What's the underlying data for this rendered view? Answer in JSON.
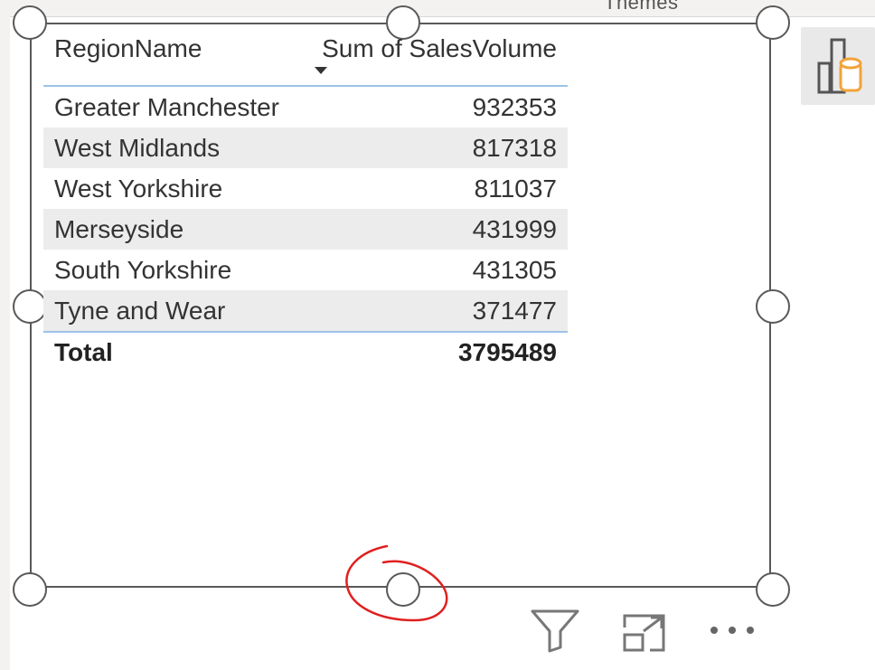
{
  "ribbon": {
    "themes_label": "Themes"
  },
  "table": {
    "headers": {
      "region": "RegionName",
      "sales": "Sum of SalesVolume"
    },
    "rows": [
      {
        "region": "Greater Manchester",
        "value": "932353"
      },
      {
        "region": "West Midlands",
        "value": "817318"
      },
      {
        "region": "West Yorkshire",
        "value": "811037"
      },
      {
        "region": "Merseyside",
        "value": "431999"
      },
      {
        "region": "South Yorkshire",
        "value": "431305"
      },
      {
        "region": "Tyne and Wear",
        "value": "371477"
      }
    ],
    "total": {
      "label": "Total",
      "value": "3795489"
    }
  },
  "icons": {
    "side_pane": "data-table-icon",
    "filter": "filter-icon",
    "focus_mode": "focus-mode-icon",
    "more_options": "more-options-icon"
  },
  "colors": {
    "frame_border": "#595959",
    "header_rule": "#9cc3e6",
    "annotation": "#e02020",
    "side_pane_accent": "#f2a33a"
  }
}
